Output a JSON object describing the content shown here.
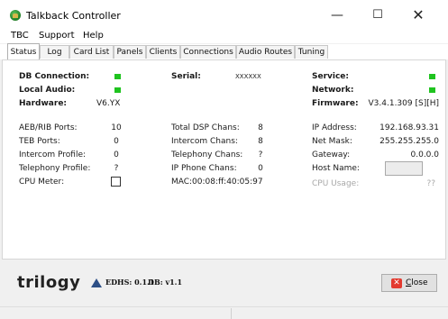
{
  "window": {
    "title": "Talkback Controller",
    "minimize": "—",
    "maximize": "☐",
    "close": "✕"
  },
  "menu": [
    "TBC",
    "Support",
    "Help"
  ],
  "tabs": [
    "Status",
    "Log",
    "Card List",
    "Panels",
    "Clients",
    "Connections",
    "Audio Routes",
    "Tuning"
  ],
  "active_tab": "Status",
  "status": {
    "db_connection": {
      "label": "DB Connection:",
      "led_color": "#1fc31f"
    },
    "local_audio": {
      "label": "Local Audio:",
      "led_color": "#1fc31f"
    },
    "hardware": {
      "label": "Hardware:",
      "value": "V6.YX"
    },
    "serial": {
      "label": "Serial:",
      "value": "XXXXXX"
    },
    "service": {
      "label": "Service:",
      "led_color": "#1fc31f"
    },
    "network": {
      "label": "Network:",
      "led_color": "#1fc31f"
    },
    "firmware": {
      "label": "Firmware:",
      "value": "V3.4.1.309 [S][H]"
    },
    "col1": [
      {
        "label": "AEB/RIB Ports:",
        "value": "10"
      },
      {
        "label": "TEB Ports:",
        "value": "0"
      },
      {
        "label": "Intercom Profile:",
        "value": "0"
      },
      {
        "label": "Telephony Profile:",
        "value": "?"
      }
    ],
    "cpu_meter": {
      "label": "CPU Meter:",
      "checked": false
    },
    "col2": [
      {
        "label": "Total DSP Chans:",
        "value": "8"
      },
      {
        "label": "Intercom Chans:",
        "value": "8"
      },
      {
        "label": "Telephony Chans:",
        "value": "?"
      },
      {
        "label": "IP Phone Chans:",
        "value": "0"
      }
    ],
    "mac": {
      "label": "MAC:",
      "value": "00:08:ff:40:05:97"
    },
    "col3": [
      {
        "label": "IP Address:",
        "value": "192.168.93.31"
      },
      {
        "label": "Net Mask:",
        "value": "255.255.255.0"
      },
      {
        "label": "Gateway:",
        "value": "0.0.0.0"
      }
    ],
    "host_name": {
      "label": "Host Name:",
      "value": ""
    },
    "cpu_usage": {
      "label": "CPU Usage:",
      "value": "??"
    }
  },
  "footer": {
    "logo": "trilogy",
    "edhs": "EDHS: 0.1.1",
    "db": "DB: v1.1",
    "close_prefix": "",
    "close_underlined": "C",
    "close_rest": "lose"
  }
}
